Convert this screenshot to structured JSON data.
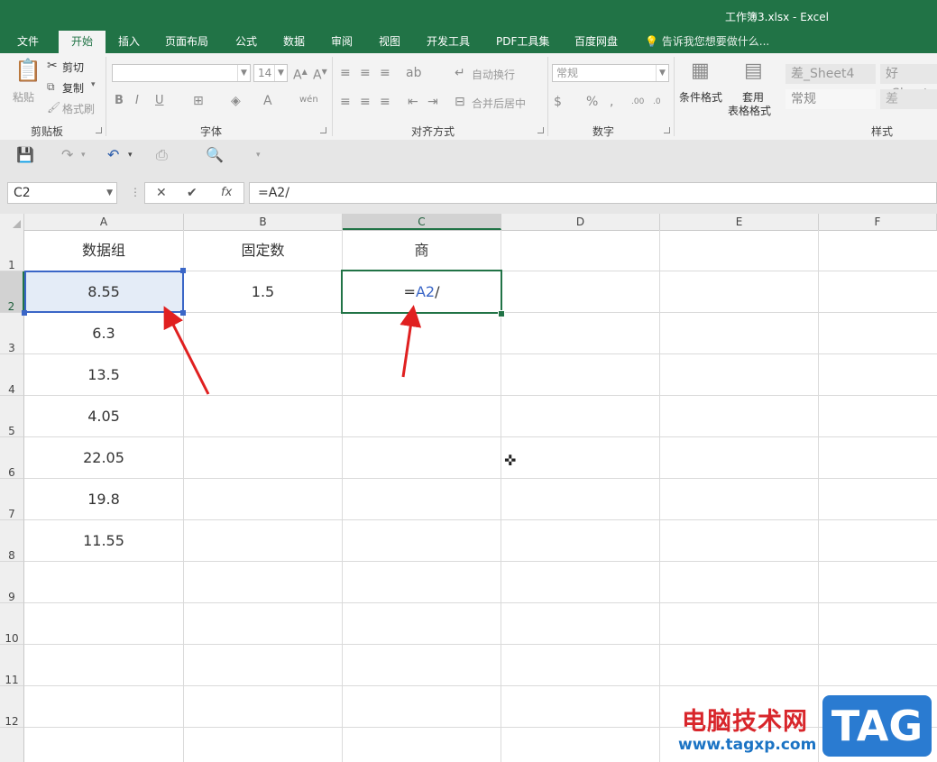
{
  "window": {
    "title": "工作簿3.xlsx - Excel"
  },
  "tabs": [
    "文件",
    "开始",
    "插入",
    "页面布局",
    "公式",
    "数据",
    "审阅",
    "视图",
    "开发工具",
    "PDF工具集",
    "百度网盘"
  ],
  "tell_me": "告诉我您想要做什么...",
  "ribbon": {
    "clipboard": {
      "paste": "粘贴",
      "cut": "剪切",
      "copy": "复制",
      "format_painter": "格式刷",
      "label": "剪贴板"
    },
    "font": {
      "font_name": "",
      "font_size": "14",
      "label": "字体"
    },
    "alignment": {
      "wrap": "自动换行",
      "merge": "合并后居中",
      "label": "对齐方式"
    },
    "number": {
      "format": "常规",
      "label": "数字"
    },
    "styles": {
      "conditional": "条件格式",
      "table_line1": "套用",
      "table_line2": "表格格式",
      "bad_sheet": "差_Sheet4",
      "good_sheet": "好_Sheet",
      "normal": "常规",
      "bad": "差",
      "label": "样式"
    }
  },
  "formula_bar": {
    "name_box": "C2",
    "formula": "=A2/",
    "fx": "fx"
  },
  "columns": [
    "A",
    "B",
    "C",
    "D",
    "E",
    "F"
  ],
  "rows": [
    "1",
    "2",
    "3",
    "4",
    "5",
    "6",
    "7",
    "8",
    "9",
    "10",
    "11",
    "12"
  ],
  "cells": {
    "A1": "数据组",
    "B1": "固定数",
    "C1": "商",
    "A2": "8.55",
    "B2": "1.5",
    "C2_prefix": "=",
    "C2_ref": "A2",
    "C2_suffix": "/",
    "A3": "6.3",
    "A4": "13.5",
    "A5": "4.05",
    "A6": "22.05",
    "A7": "19.8",
    "A8": "11.55"
  },
  "colors": {
    "excel_green": "#217346",
    "ref_blue": "#3a66c7",
    "arrow_red": "#e02020"
  },
  "watermark": {
    "site": "电脑技术网",
    "url": "www.tagxp.com",
    "badge": "TAG"
  }
}
